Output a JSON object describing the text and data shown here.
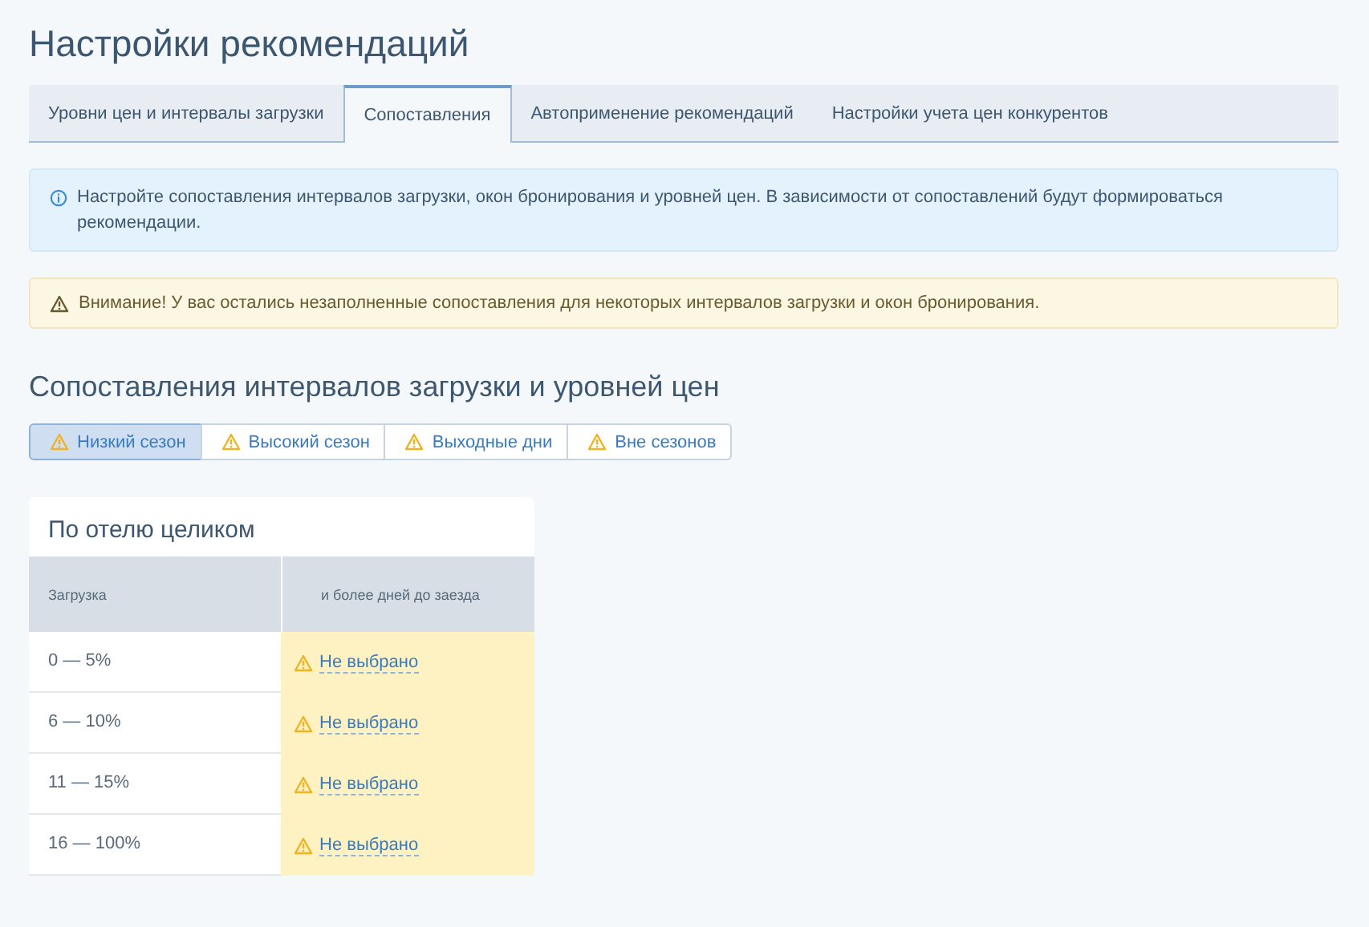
{
  "title": "Настройки рекомендаций",
  "tabs": [
    {
      "label": "Уровни цен и интервалы загрузки",
      "selected": false
    },
    {
      "label": "Сопоставления",
      "selected": true
    },
    {
      "label": "Автоприменение рекомендаций",
      "selected": false
    },
    {
      "label": "Настройки учета цен конкурентов",
      "selected": false
    }
  ],
  "info_alert": "Настройте сопоставления интервалов загрузки, окон бронирования и уровней цен. В зависимости от сопоставлений будут формироваться рекомендации.",
  "warning_alert": "Внимание! У вас остались незаполненные сопоставления для некоторых интервалов загрузки и окон бронирования.",
  "section_title": "Сопоставления интервалов загрузки и уровней цен",
  "seasons": [
    {
      "label": "Низкий сезон",
      "selected": true
    },
    {
      "label": "Высокий сезон",
      "selected": false
    },
    {
      "label": "Выходные дни",
      "selected": false
    },
    {
      "label": "Вне сезонов",
      "selected": false
    }
  ],
  "card": {
    "title": "По отелю целиком",
    "columns": [
      "Загрузка",
      "и более дней до заезда"
    ],
    "rows": [
      {
        "load": "0 — 5%",
        "value": "Не выбрано"
      },
      {
        "load": "6 — 10%",
        "value": "Не выбрано"
      },
      {
        "load": "11 — 15%",
        "value": "Не выбрано"
      },
      {
        "load": "16 — 100%",
        "value": "Не выбрано"
      }
    ]
  }
}
